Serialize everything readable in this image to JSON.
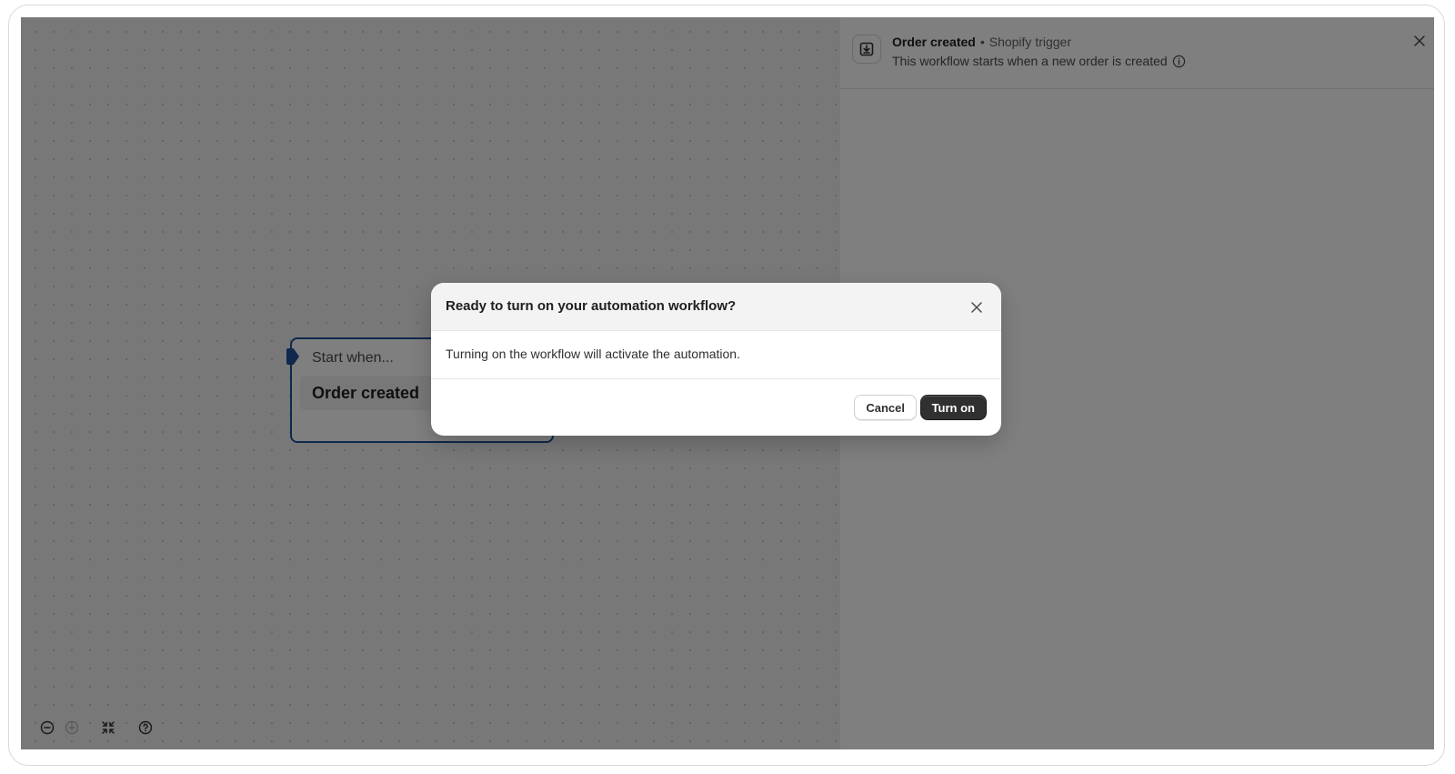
{
  "canvas": {
    "trigger_card": {
      "label": "Start when...",
      "event": "Order created"
    },
    "toolbar": {
      "zoom_out_icon": "minus-circle-icon",
      "zoom_in_icon": "plus-circle-icon",
      "fit_view_icon": "collapse-arrows-icon",
      "help_icon": "question-circle-icon"
    }
  },
  "side_panel": {
    "icon": "download-box-icon",
    "title": "Order created",
    "separator": "•",
    "subtitle": "Shopify trigger",
    "description": "This workflow starts when a new order is created"
  },
  "modal": {
    "title": "Ready to turn on your automation workflow?",
    "body": "Turning on the workflow will activate the automation.",
    "cancel_label": "Cancel",
    "confirm_label": "Turn on"
  },
  "colors": {
    "accent_blue": "#1f5199",
    "primary_button": "#303030",
    "backdrop": "rgba(0,0,0,0.5)"
  }
}
